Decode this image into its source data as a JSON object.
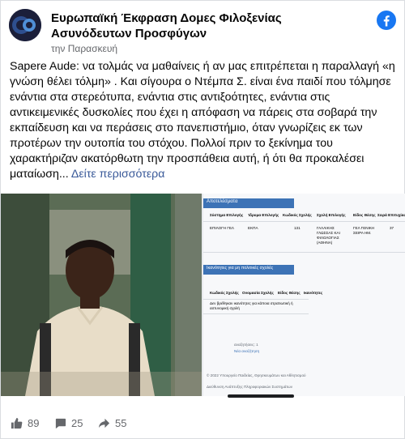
{
  "page": {
    "name": "Ευρωπαϊκή Έκφραση Δομες Φιλοξενίας Ασυνόδευτων Προσφύγων",
    "time": "την Παρασκευή"
  },
  "post": {
    "text": "Sapere Aude: να τολμάς να μαθαίνεις ή αν μας επιτρέπεται η παραλλαγή «η γνώση θέλει τόλμη» . Και σίγουρα ο Ντέμπα Σ. είναι ένα παιδί που τόλμησε ενάντια στα στερεότυπα, ενάντια στις αντιξοότητες, ενάντια στις αντικειμενικές δυσκολίες που έχει η απόφαση να πάρεις στα σοβαρά την εκπαίδευση και να περάσεις στο πανεπιστήμιο, όταν γνωρίζεις εκ των προτέρων την ουτοπία του στόχου. Πολλοί πριν το ξεκίνημα του χαρακτήριζαν ακατόρθωτη την προσπάθεια αυτή, ή ότι θα προκαλέσει ματαίωση...",
    "see_more": "Δείτε περισσότερα"
  },
  "screenshot": {
    "title": "Αποτελέσματα",
    "headers": [
      "Σύστημα Επιλογής",
      "Ίδρυμα Επιλογής",
      "Κωδικός Σχολής",
      "Σχολή Επιλογής",
      "Είδος Θέσης",
      "Σειρά Επιτυχίας"
    ],
    "row": [
      "ΕΠΙΛΟΓΗ ΓΕΛ",
      "ΕΚΠΑ",
      "131",
      "ΓΑΛΛΙΚΗΣ ΓΛΩΣΣΑΣ ΚΑΙ ΦΙΛΟΛΟΓΙΑΣ (ΑΘΗΝΑ)",
      "ΓΕΛ ΓΕΝΙΚΗ ΣΕΙΡΑ ΗΜ.",
      "37"
    ],
    "section2_title": "Ικανότητες για μη πολιτικές σχολές",
    "headers2": [
      "Κωδικός Σχολής",
      "Ονομασία Σχολής",
      "Είδος Θέσης",
      "Ικανότητες"
    ],
    "note": "Δεν βρέθηκαν ικανότητες για κάποια στρατιωτική ή αστυνομική σχολή",
    "link_search": "αναζητήσεις: 1",
    "link_new": "Νέα αναζήτηση",
    "copyright": "© 2022 Υπουργείο Παιδείας, Θρησκευμάτων και Αθλητισμού",
    "dev": "Διεύθυνση Ανάπτυξης Πληροφοριακών Συστημάτων"
  },
  "reactions": {
    "likes": "89",
    "comments": "25",
    "shares": "55"
  },
  "colors": {
    "facebook_blue": "#1877f2",
    "link": "#385898",
    "muted": "#65676b"
  }
}
